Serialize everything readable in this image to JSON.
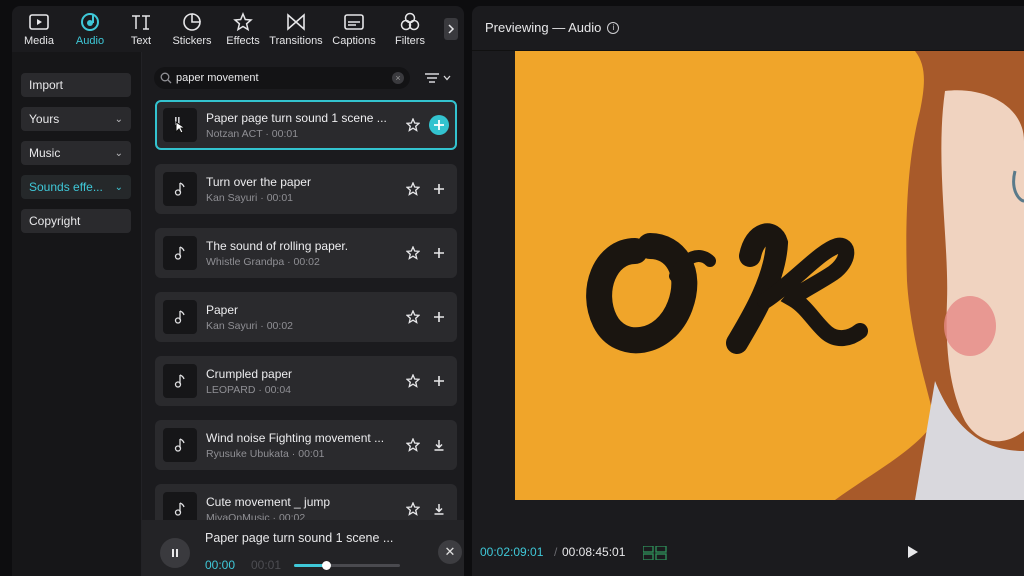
{
  "toolbar": {
    "items": [
      {
        "label": "Media",
        "icon": "media-icon"
      },
      {
        "label": "Audio",
        "icon": "audio-icon",
        "active": true
      },
      {
        "label": "Text",
        "icon": "text-icon"
      },
      {
        "label": "Stickers",
        "icon": "stickers-icon"
      },
      {
        "label": "Effects",
        "icon": "effects-icon"
      },
      {
        "label": "Transitions",
        "icon": "transitions-icon"
      },
      {
        "label": "Captions",
        "icon": "captions-icon"
      },
      {
        "label": "Filters",
        "icon": "filters-icon"
      }
    ]
  },
  "sidebar": {
    "items": [
      {
        "label": "Import"
      },
      {
        "label": "Yours",
        "chevron": true
      },
      {
        "label": "Music",
        "chevron": true
      },
      {
        "label": "Sounds effe...",
        "chevron": true,
        "active": true
      },
      {
        "label": "Copyright"
      }
    ]
  },
  "search": {
    "value": "paper movement"
  },
  "results": [
    {
      "title": "Paper page turn sound 1 scene ...",
      "author": "Notzan ACT",
      "duration": "00:01",
      "action": "add",
      "selected": true
    },
    {
      "title": "Turn over the paper",
      "author": "Kan Sayuri",
      "duration": "00:01",
      "action": "add"
    },
    {
      "title": "The sound of rolling paper.",
      "author": "Whistle Grandpa",
      "duration": "00:02",
      "action": "add"
    },
    {
      "title": "Paper",
      "author": "Kan Sayuri",
      "duration": "00:02",
      "action": "add"
    },
    {
      "title": "Crumpled paper",
      "author": "LEOPARD",
      "duration": "00:04",
      "action": "add"
    },
    {
      "title": "Wind noise Fighting movement ...",
      "author": "Ryusuke Ubukata",
      "duration": "00:01",
      "action": "download"
    },
    {
      "title": "Cute movement _ jump",
      "author": "MiyaOnMusic",
      "duration": "00:02",
      "action": "download"
    }
  ],
  "player": {
    "title": "Paper page turn sound 1 scene ...",
    "current": "00:00",
    "duration": "00:01",
    "progress": 0.3
  },
  "preview": {
    "title": "Previewing — Audio",
    "timecode_current": "00:02:09:01",
    "separator": "/",
    "timecode_total": "00:08:45:01"
  },
  "colors": {
    "accent": "#33c3cf",
    "canvas_bg": "#f0a52a"
  }
}
